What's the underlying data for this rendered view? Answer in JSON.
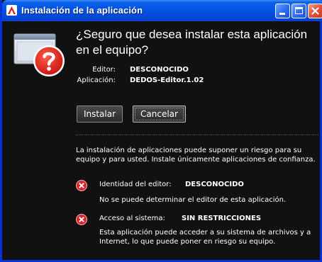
{
  "window": {
    "title": "Instalación de la aplicación",
    "icons": {
      "app": "adobe-air-icon",
      "minimize": "minimize-icon",
      "maximize": "maximize-icon",
      "close": "close-icon"
    }
  },
  "dialog": {
    "question": "¿Seguro que desea instalar esta aplicación en el equipo?",
    "graphic": "install-warning-question-icon",
    "publisher_label": "Editor:",
    "publisher_value": "DESCONOCIDO",
    "application_label": "Aplicación:",
    "application_value": "DEDOS-Editor.1.02"
  },
  "buttons": {
    "install": "Instalar",
    "cancel": "Cancelar"
  },
  "warning": {
    "text": "La instalación de aplicaciones puede suponer un riesgo para su equipo y para usted. Instale únicamente aplicaciones de confianza."
  },
  "risks": [
    {
      "icon": "error-x-icon",
      "label": "Identidad del editor:",
      "value": "DESCONOCIDO",
      "description": "No se puede determinar el editor de esta aplicación."
    },
    {
      "icon": "error-x-icon",
      "label": "Acceso al sistema:",
      "value": "SIN RESTRICCIONES",
      "description": "Esta aplicación puede acceder a su sistema de archivos y a Internet, lo que puede poner en riesgo su equipo."
    }
  ],
  "colors": {
    "titlebar": "#0454e3",
    "background": "#111111",
    "badge_red": "#d8262a",
    "question_red": "#e0201a"
  }
}
